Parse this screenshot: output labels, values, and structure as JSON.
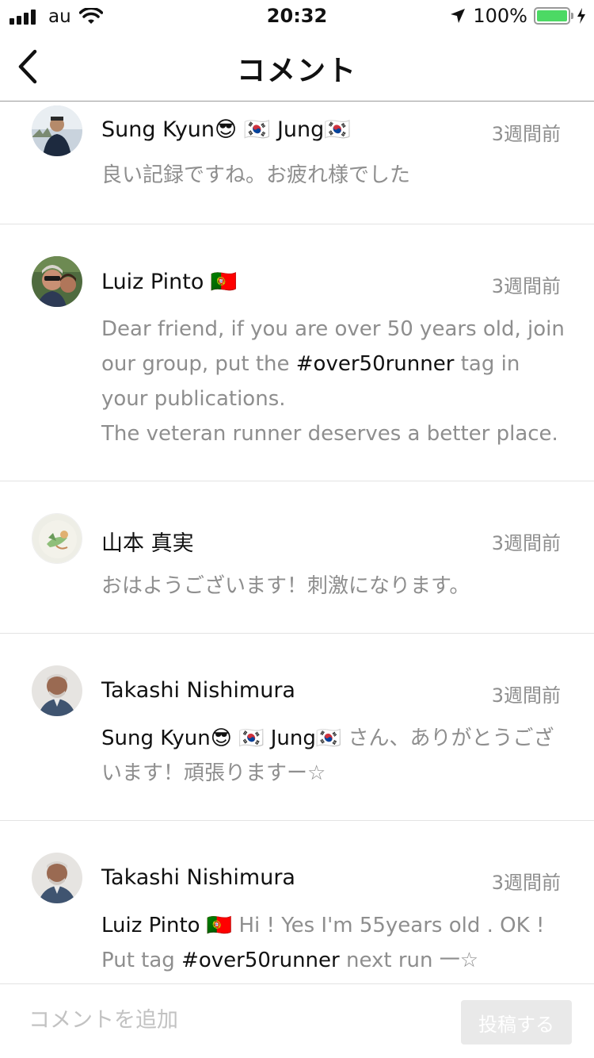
{
  "status_bar": {
    "carrier": "au",
    "time": "20:32",
    "battery": "100%"
  },
  "nav": {
    "title": "コメント",
    "back_icon": "chevron-left-icon"
  },
  "comments": [
    {
      "name": "Sung Kyun😎 🇰🇷 Jung🇰🇷",
      "time": "3週間前",
      "body": [
        {
          "t": "良い記録ですね。お疲れ様でした",
          "k": "text"
        }
      ]
    },
    {
      "name": "Luiz Pinto 🇵🇹",
      "time": "3週間前",
      "body": [
        {
          "t": "Dear friend, if you are over 50 years old, join our group, put the ",
          "k": "text"
        },
        {
          "t": "#over50runner",
          "k": "tag"
        },
        {
          "t": " tag in your publications.\nThe veteran runner deserves a better place.",
          "k": "text"
        }
      ]
    },
    {
      "name": "山本 真実",
      "time": "3週間前",
      "body": [
        {
          "t": "おはようございます！刺激になります。",
          "k": "text"
        }
      ]
    },
    {
      "name": "Takashi Nishimura",
      "time": "3週間前",
      "body": [
        {
          "t": "Sung Kyun😎 🇰🇷 Jung🇰🇷",
          "k": "mention"
        },
        {
          "t": " さん、ありがとうございます！頑張りますー☆",
          "k": "text"
        }
      ]
    },
    {
      "name": "Takashi Nishimura",
      "time": "3週間前",
      "body": [
        {
          "t": "Luiz Pinto 🇵🇹",
          "k": "mention"
        },
        {
          "t": " Hi ! Yes I'm 55years old . OK ! Put tag ",
          "k": "text"
        },
        {
          "t": "#over50runner",
          "k": "tag"
        },
        {
          "t": " next run 一☆",
          "k": "text"
        }
      ]
    }
  ],
  "input": {
    "placeholder": "コメントを追加",
    "value": "",
    "post_label": "投稿する"
  },
  "colors": {
    "text_primary": "#111111",
    "text_secondary": "#8e8e8e",
    "divider": "#e3e3e3",
    "battery": "#4cd964",
    "button_disabled": "#e9e9e9"
  }
}
